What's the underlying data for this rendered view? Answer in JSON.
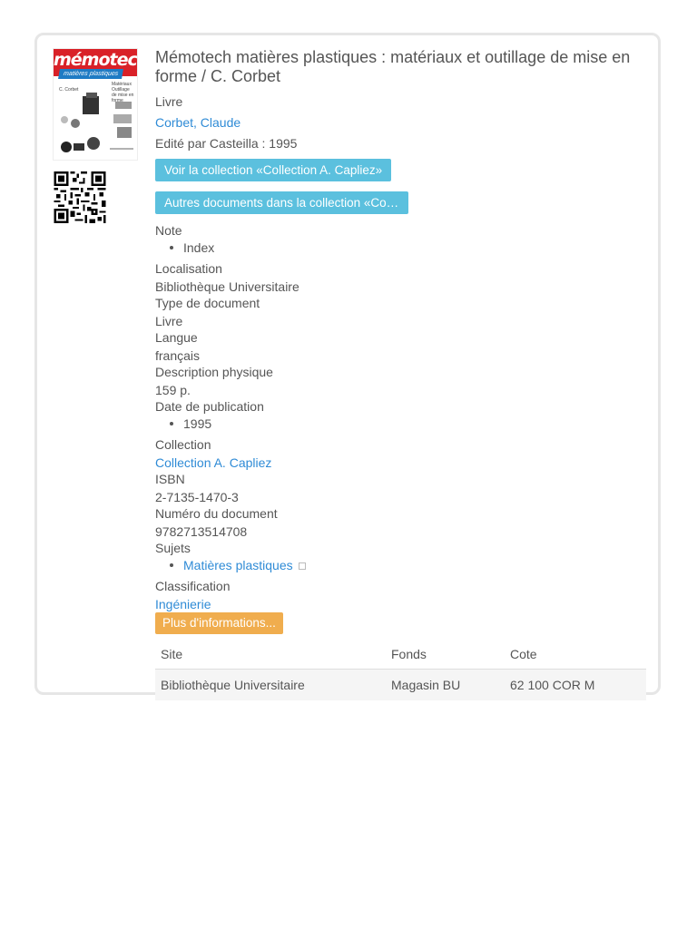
{
  "record": {
    "title": "Mémotech matières plastiques : matériaux et outillage de mise en forme / C. Corbet",
    "doc_type": "Livre",
    "author": "Corbet, Claude",
    "publisher": "Edité par Casteilla : 1995",
    "btn_collection": "Voir la collection «Collection A. Capliez»",
    "btn_other_docs": "Autres documents dans la collection «Collection A. Capliez»",
    "cover": {
      "banner": "mémotech",
      "subtitle": "matières plastiques",
      "author_small": "C. Corbet",
      "title_small": "Matériaux Outillage de mise en forme"
    },
    "qr_icon": "qr-code-icon",
    "colors": {
      "link": "#2f8bd6",
      "button_info": "#5bc0de",
      "button_warning": "#f0ad4e",
      "cover_red": "#d92128"
    }
  },
  "fields": {
    "note_label": "Note",
    "note_items": [
      "Index"
    ],
    "location_label": "Localisation",
    "location_value": "Bibliothèque Universitaire",
    "type_label": "Type de document",
    "type_value": "Livre",
    "language_label": "Langue",
    "language_value": "français",
    "physical_label": "Description physique",
    "physical_value": "159 p.",
    "date_label": "Date de publication",
    "date_items": [
      "1995"
    ],
    "collection_label": "Collection",
    "collection_value": "Collection A. Capliez",
    "isbn_label": "ISBN",
    "isbn_value": "2-7135-1470-3",
    "docnum_label": "Numéro du document",
    "docnum_value": "9782713514708",
    "subjects_label": "Sujets",
    "subject_items": [
      "Matières plastiques"
    ],
    "classification_label": "Classification",
    "classification_value": "Ingénierie",
    "more_button": "Plus d'informations..."
  },
  "holdings": {
    "headers": [
      "Site",
      "Fonds",
      "Cote"
    ],
    "rows": [
      [
        "Bibliothèque Universitaire",
        "Magasin BU",
        "62 100 COR M"
      ]
    ]
  }
}
